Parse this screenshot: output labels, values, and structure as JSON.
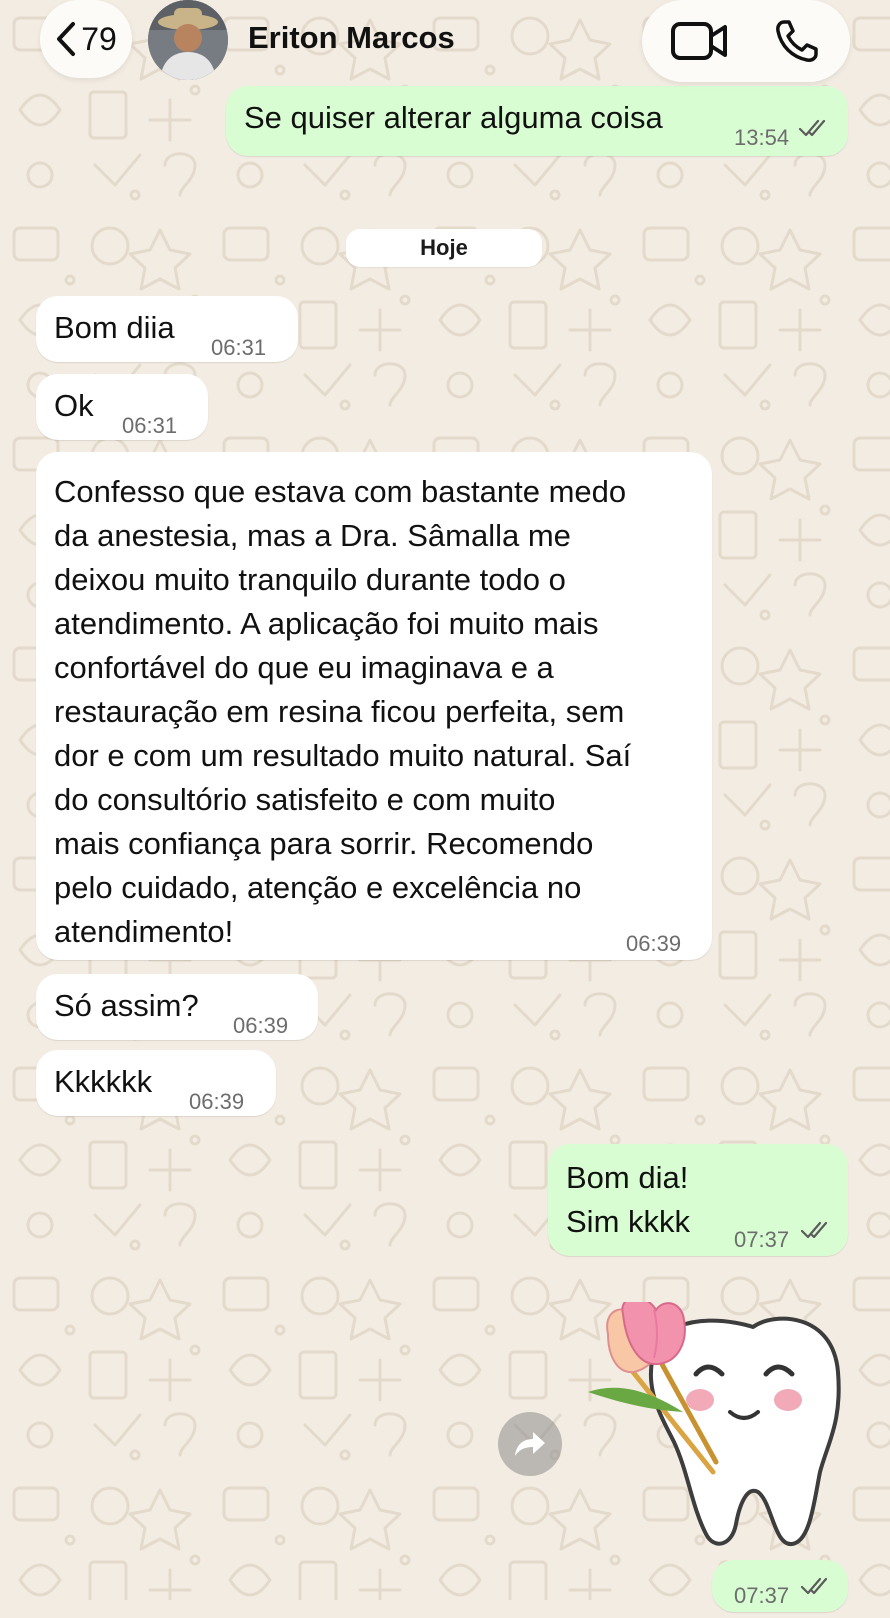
{
  "header": {
    "back_count": "79",
    "contact_name": "Eriton Marcos"
  },
  "messages": [
    {
      "id": "m0",
      "direction": "out",
      "text": "Se quiser alterar alguma coisa",
      "time": "13:54",
      "status": "read"
    },
    {
      "id": "m1",
      "direction": "in",
      "text": "Bom diia",
      "time": "06:31"
    },
    {
      "id": "m2",
      "direction": "in",
      "text": "Ok",
      "time": "06:31"
    },
    {
      "id": "m3",
      "direction": "in",
      "text": "Confesso que estava com bastante medo\nda anestesia, mas a Dra. Sâmalla me\ndeixou muito tranquilo durante todo o\natendimento. A aplicação foi muito mais\nconfortável do que eu imaginava e a\nrestauração em resina ficou perfeita, sem\ndor e com um resultado muito natural. Saí\ndo consultório satisfeito e com muito\nmais confiança para sorrir. Recomendo\npelo cuidado, atenção e excelência no\natendimento!",
      "time": "06:39"
    },
    {
      "id": "m4",
      "direction": "in",
      "text": "Só assim?",
      "time": "06:39"
    },
    {
      "id": "m5",
      "direction": "in",
      "text": "Kkkkkk",
      "time": "06:39"
    },
    {
      "id": "m6",
      "direction": "out",
      "lines": [
        "Bom dia!",
        "Sim kkkk"
      ],
      "time": "07:37",
      "status": "read"
    },
    {
      "id": "m7",
      "direction": "out",
      "type": "sticker",
      "sticker": "tooth-with-tulips",
      "time": "07:37",
      "status": "read"
    }
  ],
  "date_divider": "Hoje",
  "icons": {
    "back": "chevron-left-icon",
    "video": "video-camera-icon",
    "phone": "phone-icon",
    "forward": "forward-arrow-icon",
    "read_receipt": "double-check-icon"
  },
  "colors": {
    "wallpaper": "#f3ece2",
    "incoming_bubble": "#ffffff",
    "outgoing_bubble": "#d9fdd3",
    "read_ticks": "#5b5b5b"
  }
}
